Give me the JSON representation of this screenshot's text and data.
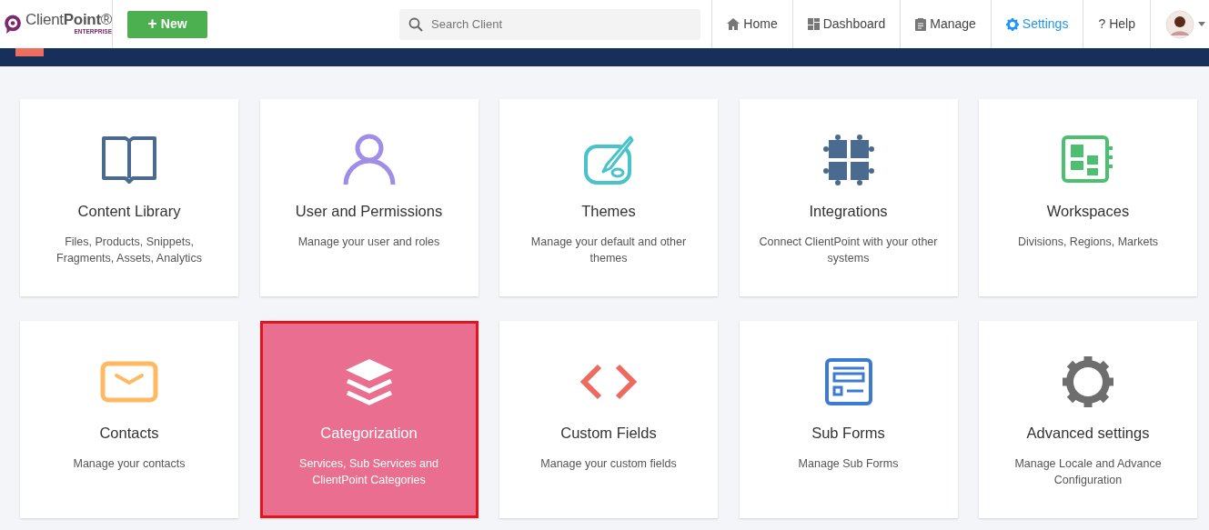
{
  "brand": {
    "name": "Client**Point**®",
    "edition": "ENTERPRISE"
  },
  "new_button": {
    "icon": "+",
    "label": "New"
  },
  "search": {
    "placeholder": "Search Client"
  },
  "nav": [
    {
      "label": "Home",
      "selected": false
    },
    {
      "label": "Dashboard",
      "selected": false
    },
    {
      "label": "Manage",
      "selected": false
    },
    {
      "label": "Settings",
      "selected": true
    },
    {
      "label": "Help",
      "icon": "?",
      "selected": false
    }
  ],
  "cards": [
    {
      "title": "Content Library",
      "description": "Files, Products, Snippets, Fragments, Assets, Analytics",
      "selected": false
    },
    {
      "title": "User and Permissions",
      "description": "Manage your user and roles",
      "selected": false
    },
    {
      "title": "Themes",
      "description": "Manage your default and other themes",
      "selected": false
    },
    {
      "title": "Integrations",
      "description": "Connect ClientPoint with your other systems",
      "selected": false
    },
    {
      "title": "Workspaces",
      "description": "Divisions, Regions, Markets",
      "selected": false
    },
    {
      "title": "Contacts",
      "description": "Manage your contacts",
      "selected": false
    },
    {
      "title": "Categorization",
      "description": "Services, Sub Services and ClientPoint Categories",
      "selected": true
    },
    {
      "title": "Custom Fields",
      "description": "Manage your custom fields",
      "selected": false
    },
    {
      "title": "Sub Forms",
      "description": "Manage Sub Forms",
      "selected": false
    },
    {
      "title": "Advanced settings",
      "description": "Manage Locale and Advance Configuration",
      "selected": false
    }
  ]
}
